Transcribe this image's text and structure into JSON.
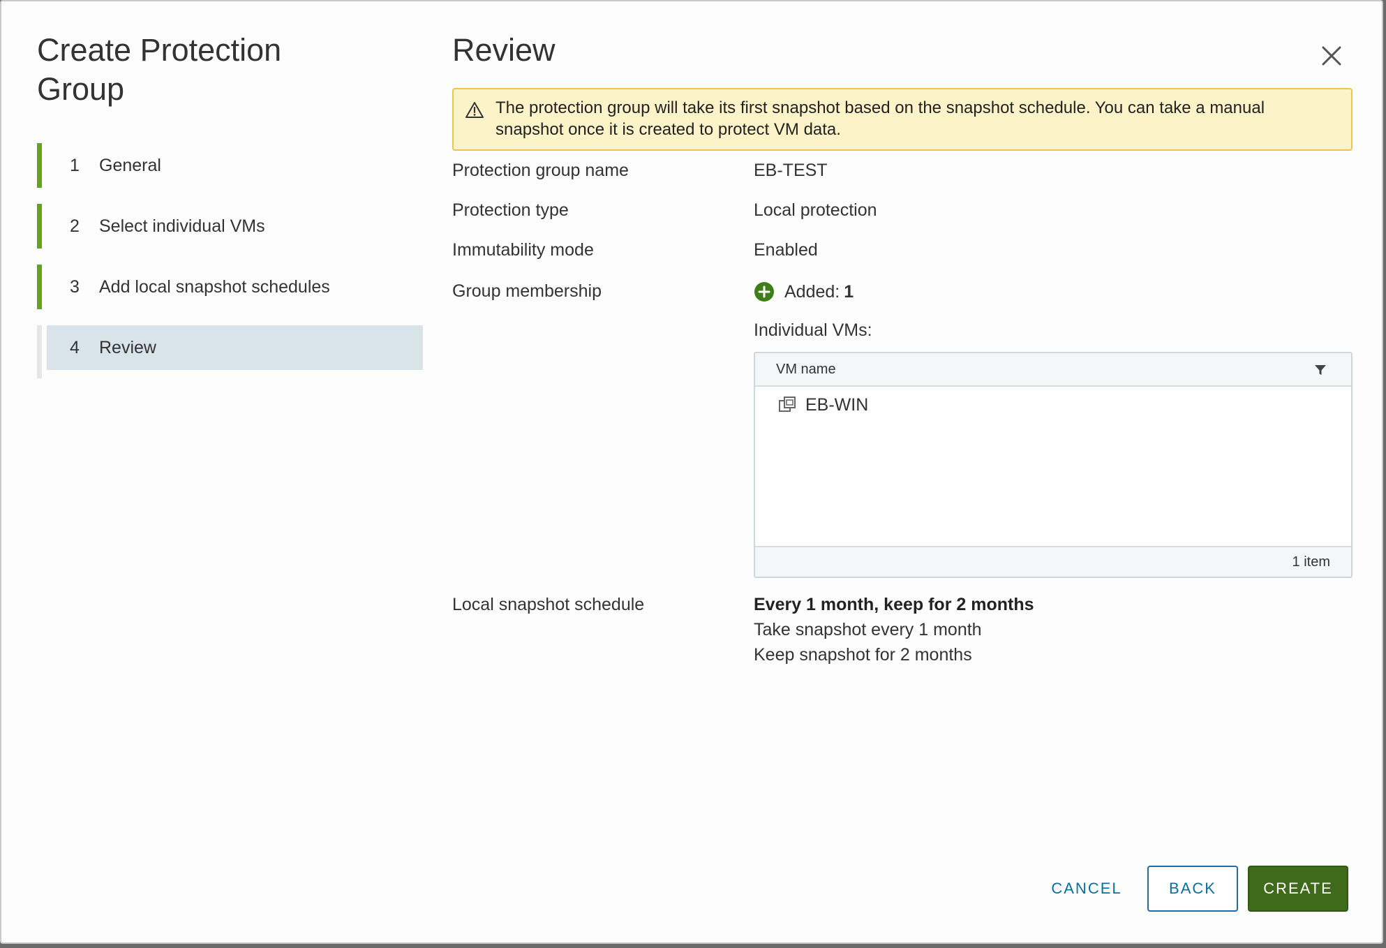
{
  "wizard": {
    "title": "Create Protection Group",
    "steps": [
      {
        "number": "1",
        "label": "General",
        "state": "complete"
      },
      {
        "number": "2",
        "label": "Select individual VMs",
        "state": "complete"
      },
      {
        "number": "3",
        "label": "Add local snapshot schedules",
        "state": "complete"
      },
      {
        "number": "4",
        "label": "Review",
        "state": "current"
      }
    ]
  },
  "page": {
    "title": "Review",
    "close_icon": "close-icon"
  },
  "alert": {
    "icon": "warning-icon",
    "text": "The protection group will take its first snapshot based on the snapshot schedule. You can take a manual snapshot once it is created to protect VM data."
  },
  "summary": {
    "name_label": "Protection group name",
    "name_value": "EB-TEST",
    "type_label": "Protection type",
    "type_value": "Local protection",
    "immutability_label": "Immutability mode",
    "immutability_value": "Enabled",
    "membership_label": "Group membership",
    "added_label": "Added:",
    "added_count": "1",
    "individual_vms_label": "Individual VMs:"
  },
  "vm_grid": {
    "column_header": "VM name",
    "rows": [
      {
        "name": "EB-WIN",
        "icon": "vm-icon"
      }
    ],
    "footer": "1 item"
  },
  "schedule": {
    "label": "Local snapshot schedule",
    "title": "Every 1 month, keep for 2 months",
    "line1": "Take snapshot every 1 month",
    "line2": "Keep snapshot for 2 months"
  },
  "buttons": {
    "cancel": "CANCEL",
    "back": "BACK",
    "create": "CREATE"
  },
  "colors": {
    "step_complete": "#62a420",
    "step_current_bg": "#d9e3ea",
    "alert_bg": "#fdf3c9",
    "alert_border": "#f0c34a",
    "added_icon": "#3e7d1a",
    "primary_button": "#3e6a1a",
    "link": "#0b6fa0"
  }
}
